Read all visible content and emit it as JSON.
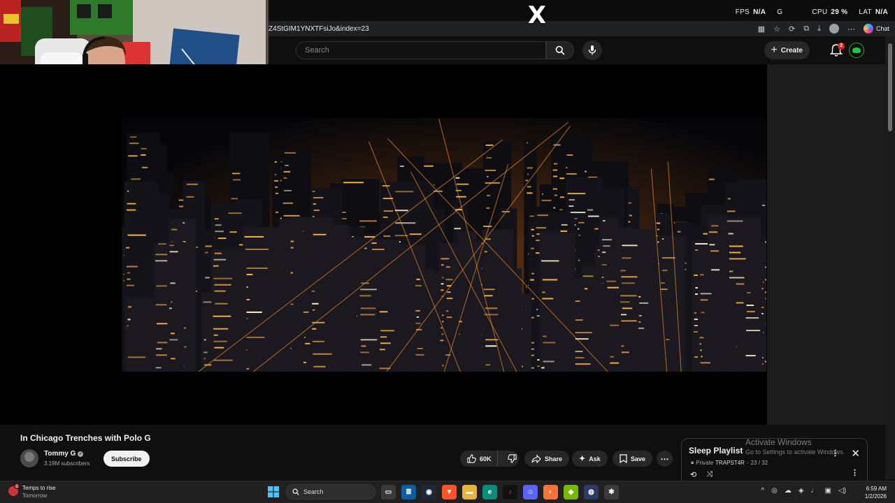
{
  "overlay": {
    "stats": [
      {
        "label": "FPS",
        "value": "N/A"
      },
      {
        "label": "GPU",
        "value": ""
      },
      {
        "label": "CPU",
        "value": "29 %"
      },
      {
        "label": "LAT",
        "value": "N/A"
      }
    ],
    "gpu_label_partial": "G"
  },
  "browser": {
    "url": "Z4StGIM1YNXTFsiJo&index=23",
    "chat_label": "Chat",
    "icons": [
      "tab-icon",
      "star-icon",
      "refresh-icon",
      "download-icon",
      "profile-icon",
      "more-icon"
    ]
  },
  "masthead": {
    "search_placeholder": "Search",
    "create_label": "Create",
    "notification_count": "2"
  },
  "video": {
    "title": "In Chicago Trenches with Polo G",
    "channel": "Tommy G",
    "subscribers": "3.19M subscribers",
    "subscribe_label": "Subscribe",
    "likes": "60K",
    "share_label": "Share",
    "ask_label": "Ask",
    "save_label": "Save"
  },
  "playlist": {
    "title": "Sleep Playlist",
    "privacy": "Private",
    "owner": "TRAPST4R",
    "position": "23 / 32"
  },
  "watermark": {
    "line1": "Activate Windows",
    "line2": "Go to Settings to activate Windows."
  },
  "taskbar": {
    "weather_line1": "Temps to rise",
    "weather_line2": "Tomorrow",
    "weather_badge": "1",
    "search_label": "Search",
    "time": "6:59 AM",
    "date": "1/2/2026"
  },
  "colors": {
    "yt_background": "#0f0f0f",
    "pill": "#272727",
    "accent_red": "#e51e1e",
    "city_light": "#ffb347"
  }
}
